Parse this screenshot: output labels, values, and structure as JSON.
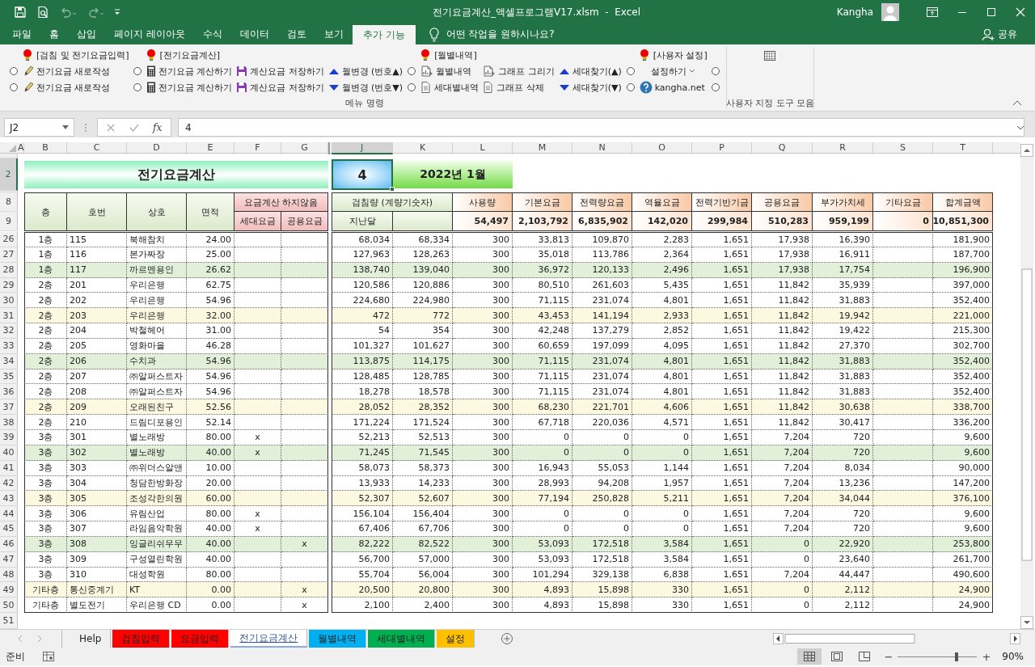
{
  "title_bar": {
    "title": "전기요금계산_액셀프로그램V17.xlsm  -  Excel",
    "user": "Kangha"
  },
  "menu_tabs": [
    {
      "label": "파일",
      "selected": false
    },
    {
      "label": "홈",
      "selected": false
    },
    {
      "label": "삽입",
      "selected": false
    },
    {
      "label": "페이지 레이아웃",
      "selected": false
    },
    {
      "label": "수식",
      "selected": false
    },
    {
      "label": "데이터",
      "selected": false
    },
    {
      "label": "검토",
      "selected": false
    },
    {
      "label": "보기",
      "selected": false
    },
    {
      "label": "추가 기능",
      "selected": true
    }
  ],
  "tell_me": "어떤 작업을 원하시나요?",
  "share": "공유",
  "ribbon": {
    "groups": [
      {
        "kind": "commands",
        "label": "메뉴 명령",
        "columns": [
          {
            "items": [
              {
                "kind": "radio",
                "selected": false
              },
              {
                "kind": "radio",
                "selected": false
              }
            ]
          },
          {
            "header": "[검침 및 전기요금입력]",
            "items": [
              {
                "kind": "write",
                "label": "전기요금 새로작성"
              },
              {
                "kind": "write",
                "label": "전기요금 새로작성"
              }
            ]
          },
          {
            "items": [
              {
                "kind": "radio",
                "selected": false
              },
              {
                "kind": "radio",
                "selected": false
              }
            ]
          },
          {
            "header": "[전기요금계산]",
            "items": [
              {
                "kind": "calculate",
                "label": "전기요금 계산하기"
              },
              {
                "kind": "calculate",
                "label": "전기요금 계산하기"
              }
            ]
          },
          {
            "items": [
              {
                "kind": "store",
                "label": "계산요금 저장하기"
              },
              {
                "kind": "store",
                "label": "계산요금 저장하기"
              }
            ]
          },
          {
            "items": [
              {
                "kind": "up",
                "label": "월변경 (번호▲)"
              },
              {
                "kind": "down",
                "label": "월변경 (번호▼)"
              }
            ]
          },
          {
            "items": [
              {
                "kind": "radio",
                "selected": false
              },
              {
                "kind": "radio",
                "selected": false
              }
            ]
          },
          {
            "header": "[월별내역]",
            "items": [
              {
                "kind": "report",
                "label": "월별내역"
              },
              {
                "kind": "sheet",
                "label": "세대별내역"
              }
            ]
          },
          {
            "items": [
              {
                "kind": "report",
                "label": "그래프 그리기"
              },
              {
                "kind": "sheet",
                "label": "그래프 삭제"
              }
            ]
          },
          {
            "items": [
              {
                "kind": "up",
                "label": "세대찾기(▲)"
              },
              {
                "kind": "down",
                "label": "세대찾기(▼)"
              }
            ]
          },
          {
            "items": [
              {
                "kind": "radio",
                "selected": false
              },
              {
                "kind": "radio",
                "selected": false
              }
            ]
          },
          {
            "header": "[사용자 설정]",
            "items": [
              {
                "kind": "menu",
                "label": "설정하기"
              },
              {
                "kind": "help",
                "label": "kangha.net"
              }
            ]
          },
          {
            "items": [
              {
                "kind": "radio",
                "selected": false
              },
              {
                "kind": "radio",
                "selected": false
              }
            ]
          }
        ]
      },
      {
        "kind": "toolbar",
        "label": "사용자 지정 도구 모음"
      }
    ]
  },
  "formula_bar": {
    "name_box": "J2",
    "insert_function": "fx",
    "formula": "4"
  },
  "sheet": {
    "column_headers": [
      {
        "label": "A",
        "selected": false
      },
      {
        "label": "B",
        "selected": false
      },
      {
        "label": "C",
        "selected": false
      },
      {
        "label": "D",
        "selected": false
      },
      {
        "label": "E",
        "selected": false
      },
      {
        "label": "F",
        "selected": false
      },
      {
        "label": "G",
        "selected": false
      },
      {
        "label": "J",
        "selected": true
      },
      {
        "label": "K",
        "selected": false
      },
      {
        "label": "L",
        "selected": false
      },
      {
        "label": "M",
        "selected": false
      },
      {
        "label": "N",
        "selected": false
      },
      {
        "label": "O",
        "selected": false
      },
      {
        "label": "P",
        "selected": false
      },
      {
        "label": "Q",
        "selected": false
      },
      {
        "label": "R",
        "selected": false
      },
      {
        "label": "S",
        "selected": false
      },
      {
        "label": "T",
        "selected": false
      }
    ],
    "title_row": {
      "row": "2",
      "selected": true,
      "title": "전기요금계산",
      "number": "4",
      "month": "2022년 1월"
    },
    "header": {
      "rows": [
        "8",
        "9"
      ],
      "left": [
        "층",
        "호번",
        "상호",
        "면적"
      ],
      "skip_label": "요금계산 하지않음",
      "skip_columns": [
        "세대요금",
        "공용요금"
      ],
      "reading_label": "검침량 (계량기숫자)",
      "reading_previous": "지난달",
      "charges": [
        {
          "label": "사용량",
          "total": "54,497"
        },
        {
          "label": "기본요금",
          "total": "2,103,792"
        },
        {
          "label": "전력량요금",
          "total": "6,835,902"
        },
        {
          "label": "역율요금",
          "total": "142,020"
        },
        {
          "label": "전력기반기금",
          "total": "299,984"
        },
        {
          "label": "공용요금",
          "total": "510,283"
        },
        {
          "label": "부가가치세",
          "total": "959,199"
        },
        {
          "label": "기타요금",
          "total": "0"
        },
        {
          "label": "합계금액",
          "total": "10,851,300"
        }
      ]
    },
    "rows": [
      {
        "row": "26",
        "cells": [
          "1층",
          "115",
          "북해참치",
          "24.00"
        ],
        "values": [
          "68,034",
          "68,334",
          "300",
          "33,813",
          "109,870",
          "2,283",
          "1,651",
          "17,938",
          "16,390"
        ],
        "total": "181,900"
      },
      {
        "row": "27",
        "cells": [
          "1층",
          "116",
          "본가짜장",
          "25.00"
        ],
        "values": [
          "127,963",
          "128,263",
          "300",
          "35,018",
          "113,786",
          "2,364",
          "1,651",
          "17,938",
          "16,911"
        ],
        "total": "187,700"
      },
      {
        "row": "28",
        "color": "#e2f0d9",
        "cells": [
          "1층",
          "117",
          "까르멘용인",
          "26.62"
        ],
        "values": [
          "138,740",
          "139,040",
          "300",
          "36,972",
          "120,133",
          "2,496",
          "1,651",
          "17,938",
          "17,754"
        ],
        "total": "196,900"
      },
      {
        "row": "29",
        "cells": [
          "2층",
          "201",
          "우리은행",
          "62.75"
        ],
        "values": [
          "120,586",
          "120,886",
          "300",
          "80,510",
          "261,603",
          "5,435",
          "1,651",
          "11,842",
          "35,939"
        ],
        "total": "397,000"
      },
      {
        "row": "30",
        "cells": [
          "2층",
          "202",
          "우리은행",
          "54.96"
        ],
        "values": [
          "224,680",
          "224,980",
          "300",
          "71,115",
          "231,074",
          "4,801",
          "1,651",
          "11,842",
          "31,883"
        ],
        "total": "352,400"
      },
      {
        "row": "31",
        "color": "#fdf9e1",
        "cells": [
          "2층",
          "203",
          "우리은행",
          "32.00"
        ],
        "values": [
          "472",
          "772",
          "300",
          "43,453",
          "141,194",
          "2,933",
          "1,651",
          "11,842",
          "19,942"
        ],
        "total": "221,000"
      },
      {
        "row": "32",
        "cells": [
          "2층",
          "204",
          "박철헤어",
          "31.00"
        ],
        "values": [
          "54",
          "354",
          "300",
          "42,248",
          "137,279",
          "2,852",
          "1,651",
          "11,842",
          "19,422"
        ],
        "total": "215,300"
      },
      {
        "row": "33",
        "cells": [
          "2층",
          "205",
          "영화마을",
          "46.28"
        ],
        "values": [
          "101,327",
          "101,627",
          "300",
          "60,659",
          "197,099",
          "4,095",
          "1,651",
          "11,842",
          "27,370"
        ],
        "total": "302,700"
      },
      {
        "row": "34",
        "color": "#e2f0d9",
        "cells": [
          "2층",
          "206",
          "수치과",
          "54.96"
        ],
        "values": [
          "113,875",
          "114,175",
          "300",
          "71,115",
          "231,074",
          "4,801",
          "1,651",
          "11,842",
          "31,883"
        ],
        "total": "352,400"
      },
      {
        "row": "35",
        "cells": [
          "2층",
          "207",
          "㈜알퍼스트자",
          "54.96"
        ],
        "values": [
          "128,485",
          "128,785",
          "300",
          "71,115",
          "231,074",
          "4,801",
          "1,651",
          "11,842",
          "31,883"
        ],
        "total": "352,400"
      },
      {
        "row": "36",
        "cells": [
          "2층",
          "208",
          "㈜알퍼스트자",
          "54.96"
        ],
        "values": [
          "18,278",
          "18,578",
          "300",
          "71,115",
          "231,074",
          "4,801",
          "1,651",
          "11,842",
          "31,883"
        ],
        "total": "352,400"
      },
      {
        "row": "37",
        "color": "#fdf9e1",
        "cells": [
          "2층",
          "209",
          "오래된친구",
          "52.56"
        ],
        "values": [
          "28,052",
          "28,352",
          "300",
          "68,230",
          "221,701",
          "4,606",
          "1,651",
          "11,842",
          "30,638"
        ],
        "total": "338,700"
      },
      {
        "row": "38",
        "cells": [
          "2층",
          "210",
          "드림디포용인",
          "52.14"
        ],
        "values": [
          "171,224",
          "171,524",
          "300",
          "67,718",
          "220,036",
          "4,571",
          "1,651",
          "11,842",
          "30,417"
        ],
        "total": "336,200"
      },
      {
        "row": "39",
        "cells": [
          "3층",
          "301",
          "별노래방",
          "80.00"
        ],
        "skip_household": "x",
        "values": [
          "52,213",
          "52,513",
          "300",
          "0",
          "0",
          "0",
          "1,651",
          "7,204",
          "720"
        ],
        "total": "9,600"
      },
      {
        "row": "40",
        "color": "#e2f0d9",
        "cells": [
          "3층",
          "302",
          "별노래방",
          "40.00"
        ],
        "skip_household": "x",
        "values": [
          "71,245",
          "71,545",
          "300",
          "0",
          "0",
          "0",
          "1,651",
          "7,204",
          "720"
        ],
        "total": "9,600"
      },
      {
        "row": "41",
        "cells": [
          "3층",
          "303",
          "㈜위더스알앤",
          "10.00"
        ],
        "values": [
          "58,073",
          "58,373",
          "300",
          "16,943",
          "55,053",
          "1,144",
          "1,651",
          "7,204",
          "8,034"
        ],
        "total": "90,000"
      },
      {
        "row": "42",
        "cells": [
          "3층",
          "304",
          "청담한방화장",
          "20.00"
        ],
        "values": [
          "13,933",
          "14,233",
          "300",
          "28,993",
          "94,208",
          "1,957",
          "1,651",
          "7,204",
          "13,236"
        ],
        "total": "147,200"
      },
      {
        "row": "43",
        "color": "#fdf9e1",
        "cells": [
          "3층",
          "305",
          "조성각한의원",
          "60.00"
        ],
        "values": [
          "52,307",
          "52,607",
          "300",
          "77,194",
          "250,828",
          "5,211",
          "1,651",
          "7,204",
          "34,044"
        ],
        "total": "376,100"
      },
      {
        "row": "44",
        "cells": [
          "3층",
          "306",
          "유림산업",
          "80.00"
        ],
        "skip_household": "x",
        "values": [
          "156,104",
          "156,404",
          "300",
          "0",
          "0",
          "0",
          "1,651",
          "7,204",
          "720"
        ],
        "total": "9,600"
      },
      {
        "row": "45",
        "cells": [
          "3층",
          "307",
          "라임음악학원",
          "40.00"
        ],
        "skip_household": "x",
        "values": [
          "67,406",
          "67,706",
          "300",
          "0",
          "0",
          "0",
          "1,651",
          "7,204",
          "720"
        ],
        "total": "9,600"
      },
      {
        "row": "46",
        "color": "#e2f0d9",
        "cells": [
          "3층",
          "308",
          "잉글리쉬무무",
          "40.00"
        ],
        "skip_common": "x",
        "values": [
          "82,222",
          "82,522",
          "300",
          "53,093",
          "172,518",
          "3,584",
          "1,651",
          "0",
          "22,920"
        ],
        "total": "253,800"
      },
      {
        "row": "47",
        "cells": [
          "3층",
          "309",
          "구성열린학원",
          "40.00"
        ],
        "values": [
          "56,700",
          "57,000",
          "300",
          "53,093",
          "172,518",
          "3,584",
          "1,651",
          "0",
          "23,640"
        ],
        "total": "261,700"
      },
      {
        "row": "48",
        "cells": [
          "3층",
          "310",
          "대성학원",
          "80.00"
        ],
        "values": [
          "55,704",
          "56,004",
          "300",
          "101,294",
          "329,138",
          "6,838",
          "1,651",
          "7,204",
          "44,447"
        ],
        "total": "490,600"
      },
      {
        "row": "49",
        "color": "#fdf9e1",
        "cells": [
          "기타층",
          "통신중계기",
          "KT",
          "0.00"
        ],
        "skip_common": "x",
        "values": [
          "20,500",
          "20,800",
          "300",
          "4,893",
          "15,898",
          "330",
          "1,651",
          "0",
          "2,112"
        ],
        "total": "24,900"
      },
      {
        "row": "50",
        "cells": [
          "기타층",
          "별도전기",
          "우리은행 CD",
          "0.00"
        ],
        "skip_common": "x",
        "values": [
          "2,100",
          "2,400",
          "300",
          "4,893",
          "15,898",
          "330",
          "1,651",
          "0",
          "2,112"
        ],
        "total": "24,900"
      }
    ],
    "last_row": "51"
  },
  "sheet_tabs": [
    {
      "label": "Help",
      "selected": false
    },
    {
      "label": "검침입력",
      "selected": false,
      "color": "#ff0000"
    },
    {
      "label": "요금입력",
      "selected": false,
      "color": "#ff0000"
    },
    {
      "label": "전기요금계산",
      "selected": true
    },
    {
      "label": "월별내역",
      "selected": false,
      "color": "#00b0f0"
    },
    {
      "label": "세대별내역",
      "selected": false,
      "color": "#00b050"
    },
    {
      "label": "설정",
      "selected": false,
      "color": "#ffc000"
    }
  ],
  "status_bar": {
    "text": "준비",
    "views": [
      {
        "kind": "normal",
        "selected": true
      },
      {
        "kind": "layout",
        "selected": false
      },
      {
        "kind": "break",
        "selected": false
      }
    ],
    "zoom_out": "−",
    "zoom_in": "+",
    "zoom": {
      "level": 0.74
    },
    "zoom_text": "90%"
  }
}
